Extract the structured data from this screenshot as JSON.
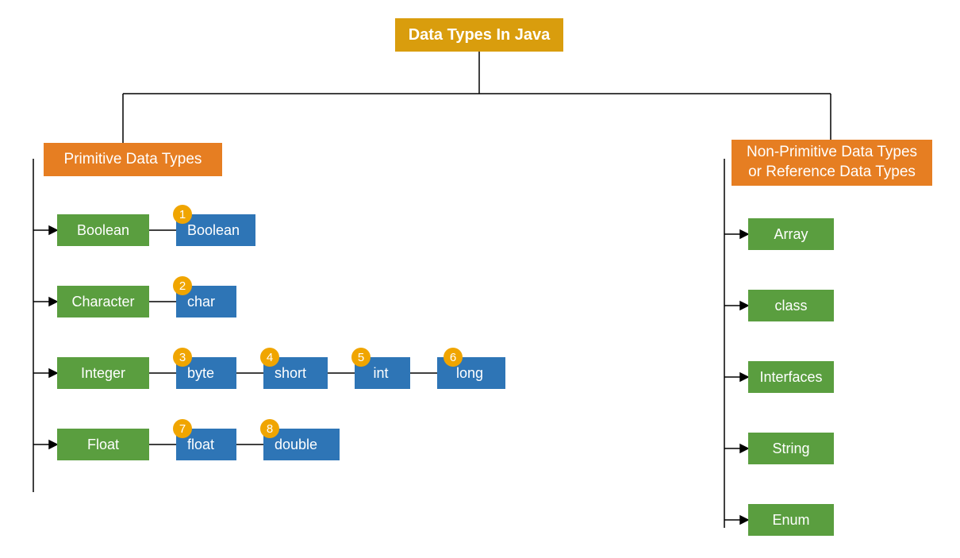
{
  "title": "Data Types In Java",
  "primitive": {
    "header": "Primitive Data Types",
    "categories": {
      "boolean": {
        "label": "Boolean",
        "types": [
          {
            "num": "1",
            "name": "Boolean"
          }
        ]
      },
      "character": {
        "label": "Character",
        "types": [
          {
            "num": "2",
            "name": "char"
          }
        ]
      },
      "integer": {
        "label": "Integer",
        "types": [
          {
            "num": "3",
            "name": "byte"
          },
          {
            "num": "4",
            "name": "short"
          },
          {
            "num": "5",
            "name": "int"
          },
          {
            "num": "6",
            "name": "long"
          }
        ]
      },
      "float": {
        "label": "Float",
        "types": [
          {
            "num": "7",
            "name": "float"
          },
          {
            "num": "8",
            "name": "double"
          }
        ]
      }
    }
  },
  "nonprimitive": {
    "header": "Non-Primitive Data Types or Reference Data Types",
    "items": [
      "Array",
      "class",
      "Interfaces",
      "String",
      "Enum"
    ]
  }
}
